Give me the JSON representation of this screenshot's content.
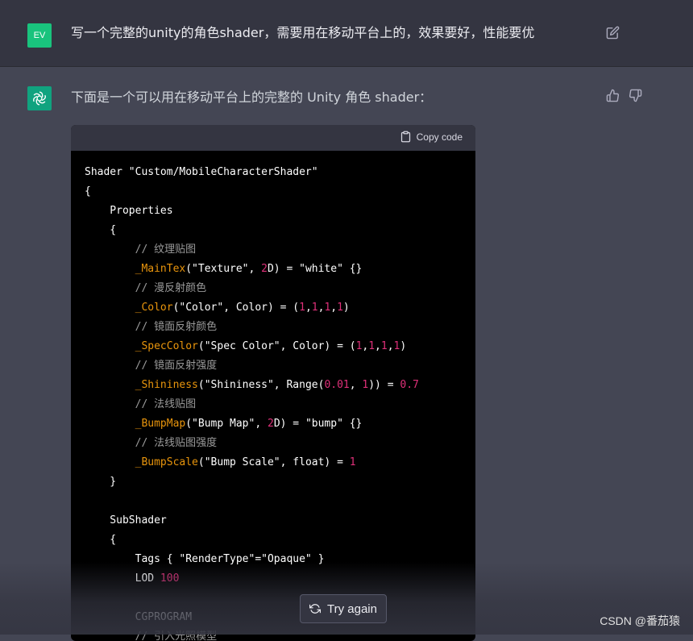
{
  "user": {
    "avatar_initials": "EV",
    "message": "写一个完整的unity的角色shader，需要用在移动平台上的，效果要好，性能要优"
  },
  "assistant": {
    "intro": "下面是一个可以用在移动平台上的完整的 Unity 角色 shader："
  },
  "code": {
    "copy_label": "Copy code",
    "lines": [
      [
        [
          "t",
          "Shader \"Custom/MobileCharacterShader\""
        ]
      ],
      [
        [
          "t",
          "{"
        ]
      ],
      [
        [
          "t",
          "    Properties"
        ]
      ],
      [
        [
          "t",
          "    {"
        ]
      ],
      [
        [
          "c",
          "        // 纹理贴图"
        ]
      ],
      [
        [
          "n",
          "        _MainTex"
        ],
        [
          "t",
          "(\"Texture\", "
        ],
        [
          "f",
          "2"
        ],
        [
          "t",
          "D) = \"white\" {}"
        ]
      ],
      [
        [
          "c",
          "        // 漫反射颜色"
        ]
      ],
      [
        [
          "n",
          "        _Color"
        ],
        [
          "t",
          "(\"Color\", Color) = ("
        ],
        [
          "f",
          "1"
        ],
        [
          "t",
          ","
        ],
        [
          "f",
          "1"
        ],
        [
          "t",
          ","
        ],
        [
          "f",
          "1"
        ],
        [
          "t",
          ","
        ],
        [
          "f",
          "1"
        ],
        [
          "t",
          ")"
        ]
      ],
      [
        [
          "c",
          "        // 镜面反射颜色"
        ]
      ],
      [
        [
          "n",
          "        _SpecColor"
        ],
        [
          "t",
          "(\"Spec Color\", Color) = ("
        ],
        [
          "f",
          "1"
        ],
        [
          "t",
          ","
        ],
        [
          "f",
          "1"
        ],
        [
          "t",
          ","
        ],
        [
          "f",
          "1"
        ],
        [
          "t",
          ","
        ],
        [
          "f",
          "1"
        ],
        [
          "t",
          ")"
        ]
      ],
      [
        [
          "c",
          "        // 镜面反射强度"
        ]
      ],
      [
        [
          "n",
          "        _Shininess"
        ],
        [
          "t",
          "(\"Shininess\", Range("
        ],
        [
          "f",
          "0.01"
        ],
        [
          "t",
          ", "
        ],
        [
          "f",
          "1"
        ],
        [
          "t",
          ")) = "
        ],
        [
          "f",
          "0.7"
        ]
      ],
      [
        [
          "c",
          "        // 法线贴图"
        ]
      ],
      [
        [
          "n",
          "        _BumpMap"
        ],
        [
          "t",
          "(\"Bump Map\", "
        ],
        [
          "f",
          "2"
        ],
        [
          "t",
          "D) = \"bump\" {}"
        ]
      ],
      [
        [
          "c",
          "        // 法线贴图强度"
        ]
      ],
      [
        [
          "n",
          "        _BumpScale"
        ],
        [
          "t",
          "(\"Bump Scale\", float) = "
        ],
        [
          "f",
          "1"
        ]
      ],
      [
        [
          "t",
          "    }"
        ]
      ],
      [
        [
          "t",
          ""
        ]
      ],
      [
        [
          "t",
          "    SubShader"
        ]
      ],
      [
        [
          "t",
          "    {"
        ]
      ],
      [
        [
          "t",
          "        Tags { \"RenderType\"=\"Opaque\" }"
        ]
      ],
      [
        [
          "t",
          "        LOD "
        ],
        [
          "f",
          "100"
        ]
      ],
      [
        [
          "t",
          ""
        ]
      ],
      [
        [
          "t",
          "        CGPROGRAM"
        ]
      ],
      [
        [
          "c",
          "        // 引入光照模型"
        ]
      ]
    ]
  },
  "try_again_label": "Try again",
  "watermark": "CSDN @番茄猿",
  "colors": {
    "accent_user": "#19c37d",
    "accent_assistant": "#10a37f",
    "code_keyword": "#df3079",
    "code_name": "#e9950c"
  },
  "icons": [
    "edit-icon",
    "openai-logo-icon",
    "thumbs-up-icon",
    "thumbs-down-icon",
    "clipboard-icon",
    "refresh-icon"
  ]
}
